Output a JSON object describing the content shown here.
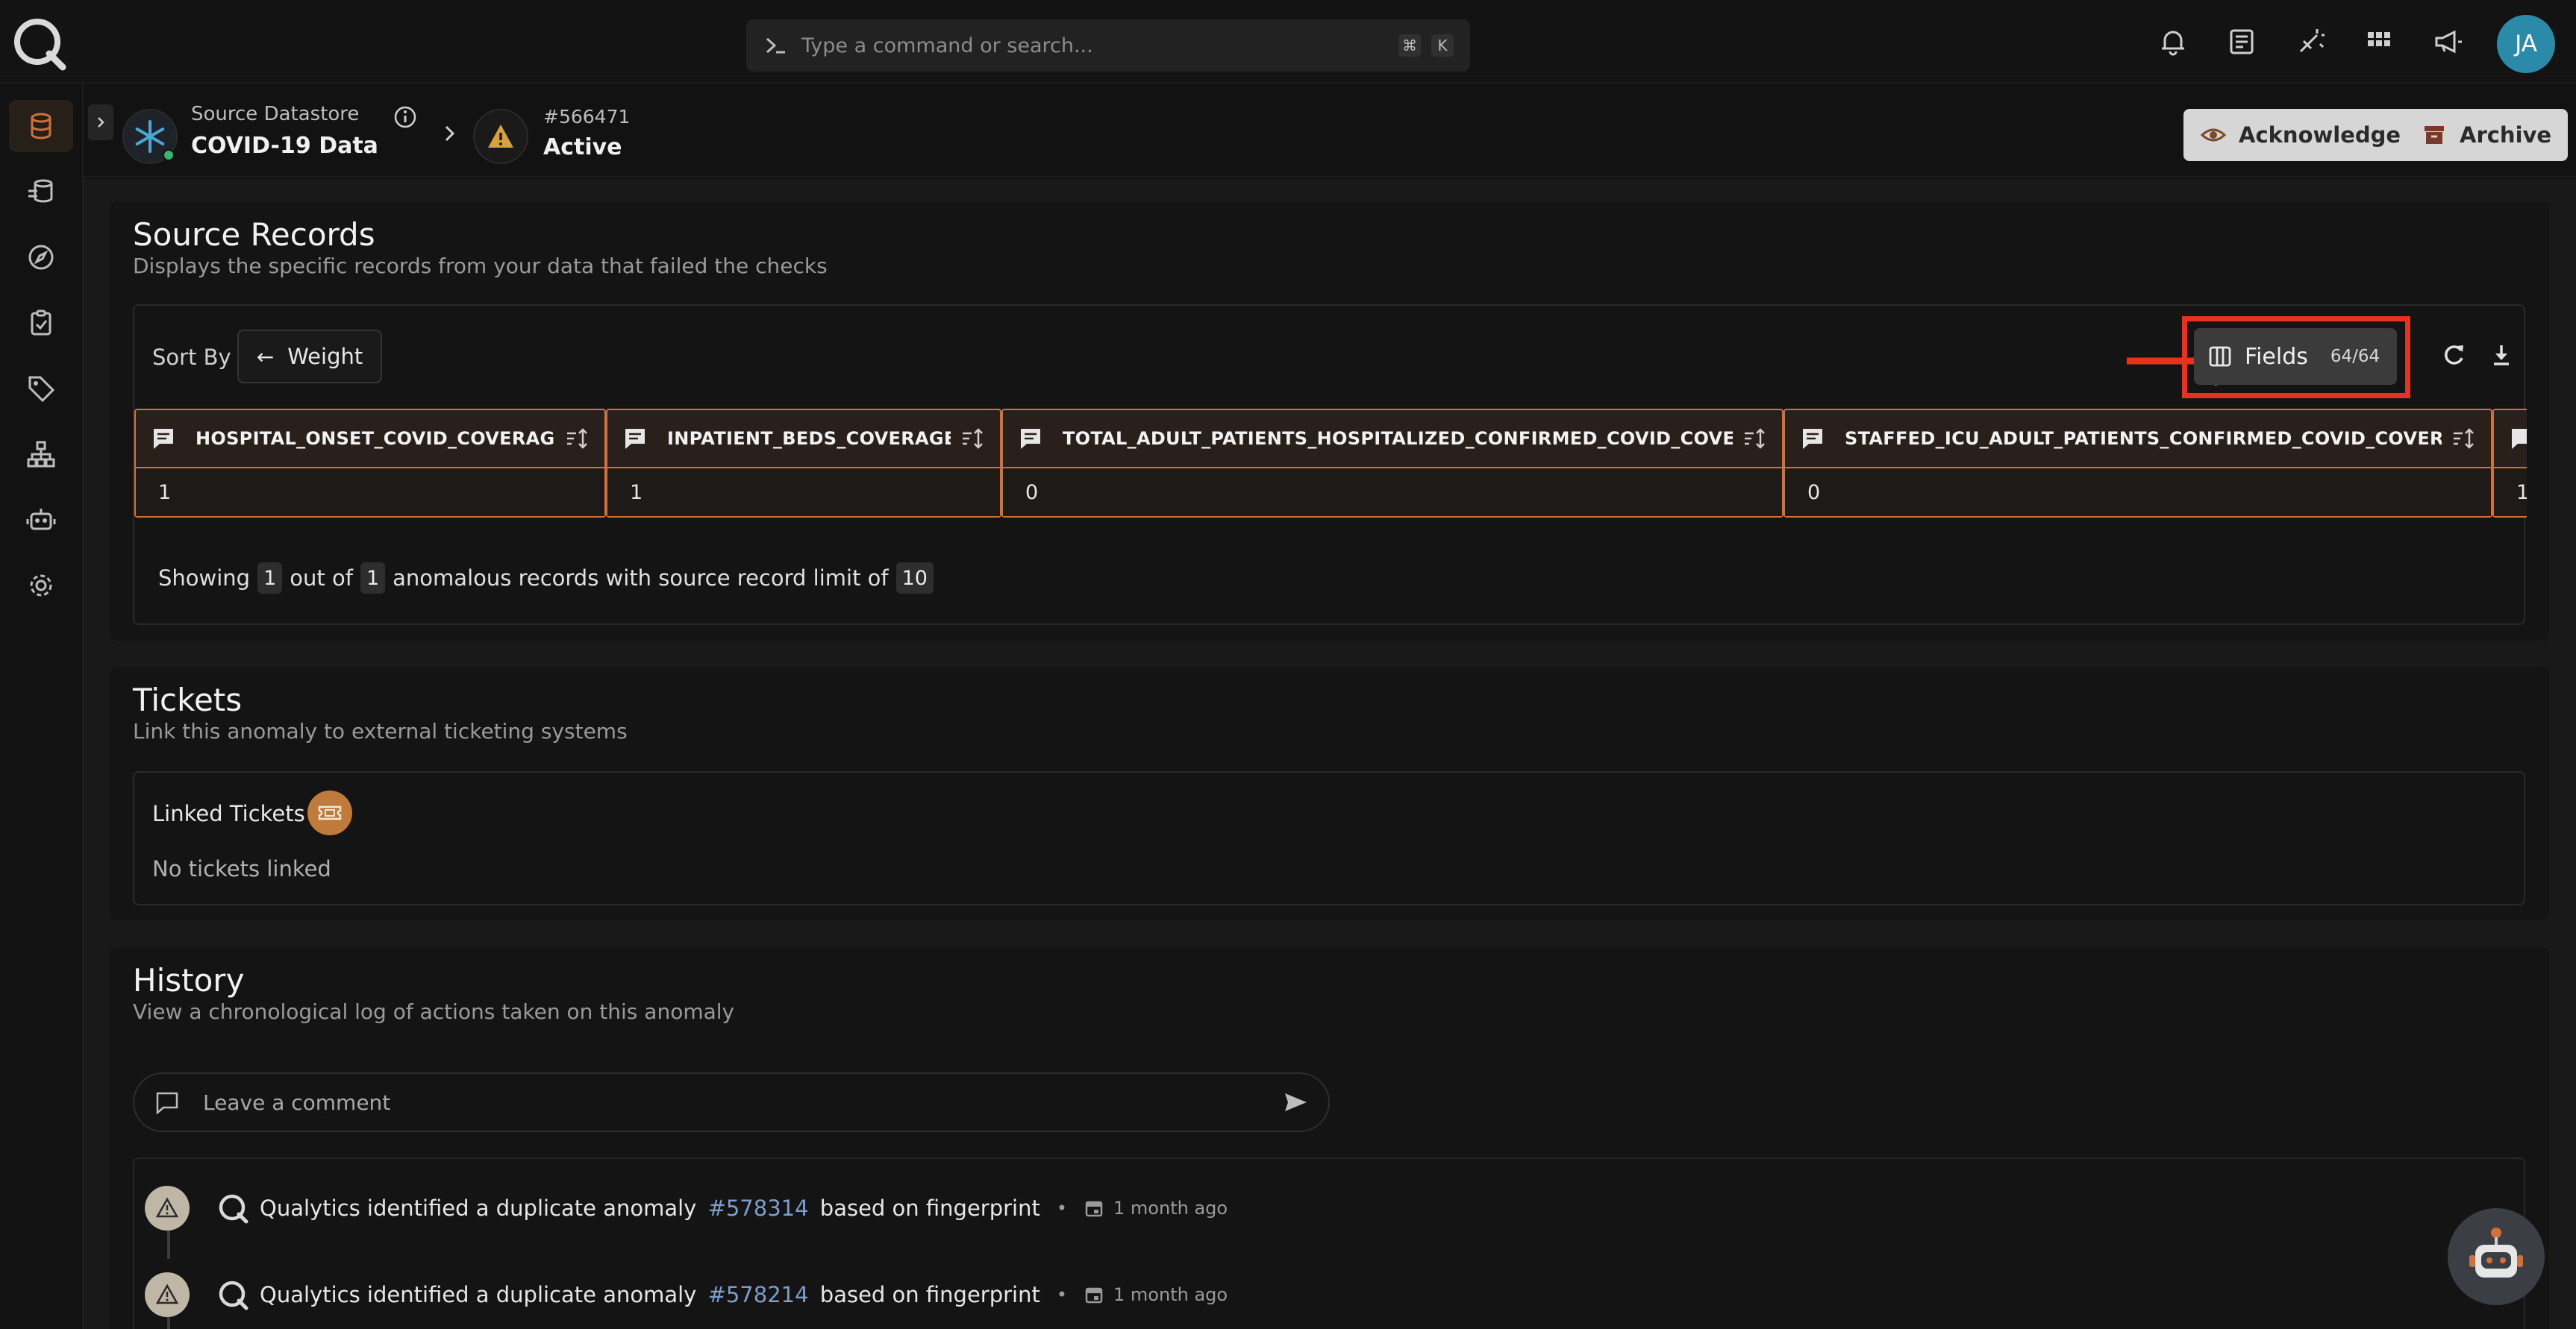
{
  "topbar": {
    "search_placeholder": "Type a command or search...",
    "shortcut_keys": [
      "⌘",
      "K"
    ],
    "icons": [
      "bell-icon",
      "document-icon",
      "wand-icon",
      "apps-grid-icon",
      "megaphone-icon"
    ],
    "avatar_initials": "JA"
  },
  "sidebar": {
    "items": [
      {
        "name": "datastores",
        "icon": "database-icon",
        "active": true
      },
      {
        "name": "enrichment",
        "icon": "layers-icon",
        "active": false
      },
      {
        "name": "explore",
        "icon": "compass-icon",
        "active": false
      },
      {
        "name": "checks",
        "icon": "clipboard-check-icon",
        "active": false
      },
      {
        "name": "tags",
        "icon": "tag-icon",
        "active": false
      },
      {
        "name": "flows",
        "icon": "hierarchy-icon",
        "active": false
      },
      {
        "name": "agents",
        "icon": "robot-icon",
        "active": false
      },
      {
        "name": "settings",
        "icon": "gear-icon",
        "active": false
      }
    ]
  },
  "header": {
    "datastore_label": "Source Datastore",
    "datastore_name": "COVID-19 Data",
    "anomaly_id": "#566471",
    "anomaly_status": "Active",
    "acknowledge_label": "Acknowledge",
    "archive_label": "Archive"
  },
  "source_records": {
    "title": "Source Records",
    "subtitle": "Displays the specific records from your data that failed the checks",
    "sort_by_label": "Sort By",
    "sort_value": "Weight",
    "fields_label": "Fields",
    "fields_count": "64/64",
    "columns": [
      {
        "header": "HOSPITAL_ONSET_COVID_COVERAGE",
        "value": "1"
      },
      {
        "header": "INPATIENT_BEDS_COVERAGE",
        "value": "1"
      },
      {
        "header": "TOTAL_ADULT_PATIENTS_HOSPITALIZED_CONFIRMED_COVID_COVERAGE",
        "value": "0"
      },
      {
        "header": "STAFFED_ICU_ADULT_PATIENTS_CONFIRMED_COVID_COVERAGE",
        "value": "0"
      },
      {
        "header": "",
        "value": "1"
      }
    ],
    "showing": {
      "prefix": "Showing",
      "shown": "1",
      "out_of": "out of",
      "total": "1",
      "middle": "anomalous records with source record limit of",
      "limit": "10"
    }
  },
  "tickets": {
    "title": "Tickets",
    "subtitle": "Link this anomaly to external ticketing systems",
    "linked_label": "Linked Tickets",
    "empty_text": "No tickets linked"
  },
  "history": {
    "title": "History",
    "subtitle": "View a chronological log of actions taken on this anomaly",
    "comment_placeholder": "Leave a comment",
    "entries": [
      {
        "actor": "Qualytics",
        "text_before": "identified a duplicate anomaly",
        "link": "#578314",
        "text_after": "based on fingerprint",
        "time": "1 month ago"
      },
      {
        "actor": "Qualytics",
        "text_before": "identified a duplicate anomaly",
        "link": "#578214",
        "text_after": "based on fingerprint",
        "time": "1 month ago"
      }
    ]
  },
  "colors": {
    "accent_orange": "#d0703a",
    "annotation_red": "#e8321f",
    "link_blue": "#7d9ec9"
  }
}
